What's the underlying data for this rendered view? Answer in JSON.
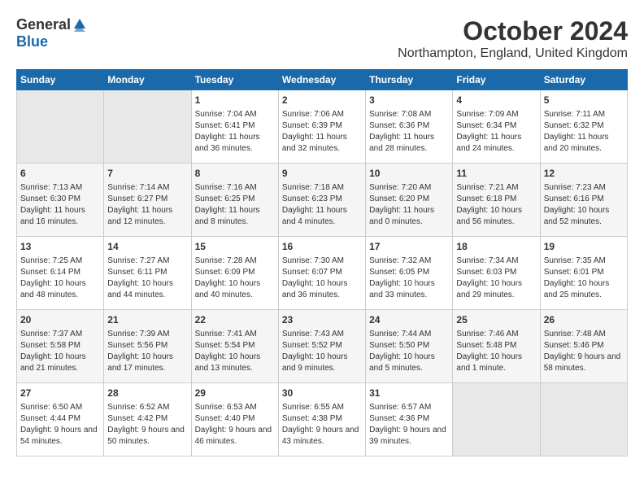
{
  "logo": {
    "general": "General",
    "blue": "Blue"
  },
  "header": {
    "title": "October 2024",
    "location": "Northampton, England, United Kingdom"
  },
  "weekdays": [
    "Sunday",
    "Monday",
    "Tuesday",
    "Wednesday",
    "Thursday",
    "Friday",
    "Saturday"
  ],
  "weeks": [
    [
      {
        "day": "",
        "empty": true
      },
      {
        "day": "",
        "empty": true
      },
      {
        "day": "1",
        "sunrise": "7:04 AM",
        "sunset": "6:41 PM",
        "daylight": "11 hours and 36 minutes."
      },
      {
        "day": "2",
        "sunrise": "7:06 AM",
        "sunset": "6:39 PM",
        "daylight": "11 hours and 32 minutes."
      },
      {
        "day": "3",
        "sunrise": "7:08 AM",
        "sunset": "6:36 PM",
        "daylight": "11 hours and 28 minutes."
      },
      {
        "day": "4",
        "sunrise": "7:09 AM",
        "sunset": "6:34 PM",
        "daylight": "11 hours and 24 minutes."
      },
      {
        "day": "5",
        "sunrise": "7:11 AM",
        "sunset": "6:32 PM",
        "daylight": "11 hours and 20 minutes."
      }
    ],
    [
      {
        "day": "6",
        "sunrise": "7:13 AM",
        "sunset": "6:30 PM",
        "daylight": "11 hours and 16 minutes."
      },
      {
        "day": "7",
        "sunrise": "7:14 AM",
        "sunset": "6:27 PM",
        "daylight": "11 hours and 12 minutes."
      },
      {
        "day": "8",
        "sunrise": "7:16 AM",
        "sunset": "6:25 PM",
        "daylight": "11 hours and 8 minutes."
      },
      {
        "day": "9",
        "sunrise": "7:18 AM",
        "sunset": "6:23 PM",
        "daylight": "11 hours and 4 minutes."
      },
      {
        "day": "10",
        "sunrise": "7:20 AM",
        "sunset": "6:20 PM",
        "daylight": "11 hours and 0 minutes."
      },
      {
        "day": "11",
        "sunrise": "7:21 AM",
        "sunset": "6:18 PM",
        "daylight": "10 hours and 56 minutes."
      },
      {
        "day": "12",
        "sunrise": "7:23 AM",
        "sunset": "6:16 PM",
        "daylight": "10 hours and 52 minutes."
      }
    ],
    [
      {
        "day": "13",
        "sunrise": "7:25 AM",
        "sunset": "6:14 PM",
        "daylight": "10 hours and 48 minutes."
      },
      {
        "day": "14",
        "sunrise": "7:27 AM",
        "sunset": "6:11 PM",
        "daylight": "10 hours and 44 minutes."
      },
      {
        "day": "15",
        "sunrise": "7:28 AM",
        "sunset": "6:09 PM",
        "daylight": "10 hours and 40 minutes."
      },
      {
        "day": "16",
        "sunrise": "7:30 AM",
        "sunset": "6:07 PM",
        "daylight": "10 hours and 36 minutes."
      },
      {
        "day": "17",
        "sunrise": "7:32 AM",
        "sunset": "6:05 PM",
        "daylight": "10 hours and 33 minutes."
      },
      {
        "day": "18",
        "sunrise": "7:34 AM",
        "sunset": "6:03 PM",
        "daylight": "10 hours and 29 minutes."
      },
      {
        "day": "19",
        "sunrise": "7:35 AM",
        "sunset": "6:01 PM",
        "daylight": "10 hours and 25 minutes."
      }
    ],
    [
      {
        "day": "20",
        "sunrise": "7:37 AM",
        "sunset": "5:58 PM",
        "daylight": "10 hours and 21 minutes."
      },
      {
        "day": "21",
        "sunrise": "7:39 AM",
        "sunset": "5:56 PM",
        "daylight": "10 hours and 17 minutes."
      },
      {
        "day": "22",
        "sunrise": "7:41 AM",
        "sunset": "5:54 PM",
        "daylight": "10 hours and 13 minutes."
      },
      {
        "day": "23",
        "sunrise": "7:43 AM",
        "sunset": "5:52 PM",
        "daylight": "10 hours and 9 minutes."
      },
      {
        "day": "24",
        "sunrise": "7:44 AM",
        "sunset": "5:50 PM",
        "daylight": "10 hours and 5 minutes."
      },
      {
        "day": "25",
        "sunrise": "7:46 AM",
        "sunset": "5:48 PM",
        "daylight": "10 hours and 1 minute."
      },
      {
        "day": "26",
        "sunrise": "7:48 AM",
        "sunset": "5:46 PM",
        "daylight": "9 hours and 58 minutes."
      }
    ],
    [
      {
        "day": "27",
        "sunrise": "6:50 AM",
        "sunset": "4:44 PM",
        "daylight": "9 hours and 54 minutes."
      },
      {
        "day": "28",
        "sunrise": "6:52 AM",
        "sunset": "4:42 PM",
        "daylight": "9 hours and 50 minutes."
      },
      {
        "day": "29",
        "sunrise": "6:53 AM",
        "sunset": "4:40 PM",
        "daylight": "9 hours and 46 minutes."
      },
      {
        "day": "30",
        "sunrise": "6:55 AM",
        "sunset": "4:38 PM",
        "daylight": "9 hours and 43 minutes."
      },
      {
        "day": "31",
        "sunrise": "6:57 AM",
        "sunset": "4:36 PM",
        "daylight": "9 hours and 39 minutes."
      },
      {
        "day": "",
        "empty": true
      },
      {
        "day": "",
        "empty": true
      }
    ]
  ]
}
